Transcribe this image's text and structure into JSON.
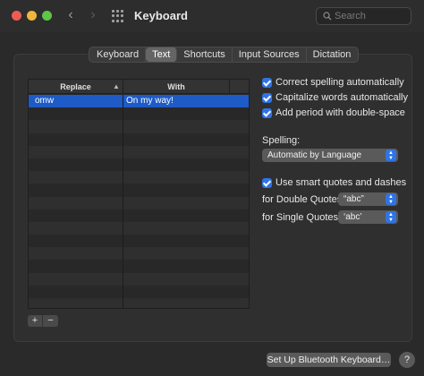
{
  "window": {
    "title": "Keyboard",
    "search_placeholder": "Search"
  },
  "tabs": [
    {
      "label": "Keyboard",
      "active": false
    },
    {
      "label": "Text",
      "active": true
    },
    {
      "label": "Shortcuts",
      "active": false
    },
    {
      "label": "Input Sources",
      "active": false
    },
    {
      "label": "Dictation",
      "active": false
    }
  ],
  "table": {
    "columns": [
      "Replace",
      "With"
    ],
    "rows": [
      {
        "replace": "omw",
        "with": "On my way!",
        "selected": true
      }
    ]
  },
  "controls": {
    "add": "+",
    "remove": "−"
  },
  "options": {
    "correct_spelling": "Correct spelling automatically",
    "capitalize_words": "Capitalize words automatically",
    "add_period": "Add period with double-space",
    "spelling_label": "Spelling:",
    "spelling_value": "Automatic by Language",
    "smart_quotes": "Use smart quotes and dashes",
    "double_quotes_label": "for Double Quotes",
    "double_quotes_value": "“abc”",
    "single_quotes_label": "for Single Quotes",
    "single_quotes_value": "‘abc’"
  },
  "footer": {
    "bluetooth_button": "Set Up Bluetooth Keyboard…",
    "help": "?"
  },
  "colors": {
    "accent": "#2f74e6",
    "selection": "#1e5bc6"
  }
}
